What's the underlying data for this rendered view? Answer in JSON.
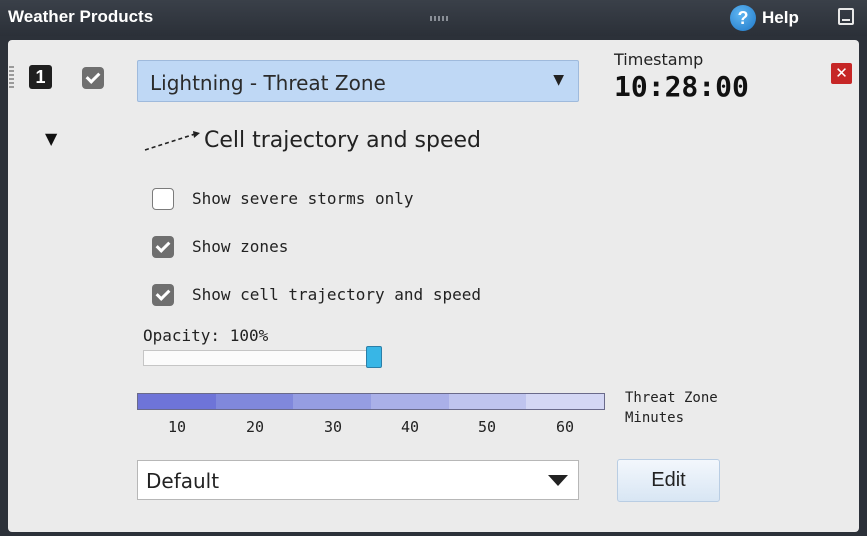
{
  "window": {
    "title": "Weather Products",
    "help_label": "Help",
    "help_glyph": "?"
  },
  "layer": {
    "number": "1",
    "enabled": true,
    "product": "Lightning - Threat Zone",
    "caret": "▼",
    "close_glyph": "✕"
  },
  "timestamp": {
    "label": "Timestamp",
    "value": "10:28:00"
  },
  "legend": {
    "expand_caret": "▼",
    "text": "Cell trajectory and speed"
  },
  "options": [
    {
      "label": "Show severe storms only",
      "checked": false
    },
    {
      "label": "Show zones",
      "checked": true
    },
    {
      "label": "Show cell trajectory and speed",
      "checked": true
    }
  ],
  "opacity": {
    "label": "Opacity: 100%",
    "value_percent": 100
  },
  "threat_scale": {
    "ticks": [
      "10",
      "20",
      "30",
      "40",
      "50",
      "60"
    ],
    "label_line1": "Threat Zone",
    "label_line2": "Minutes",
    "colors": [
      "#6e74d8",
      "#8088dc",
      "#959de2",
      "#aab0e8",
      "#bfc4ee",
      "#d4d7f4"
    ]
  },
  "color_scheme": {
    "value": "Default"
  },
  "edit_button": {
    "label": "Edit"
  },
  "icons": {
    "help": "help-icon",
    "minimize": "minimize-icon",
    "close": "close-icon",
    "grip": "drag-grip-icon"
  }
}
